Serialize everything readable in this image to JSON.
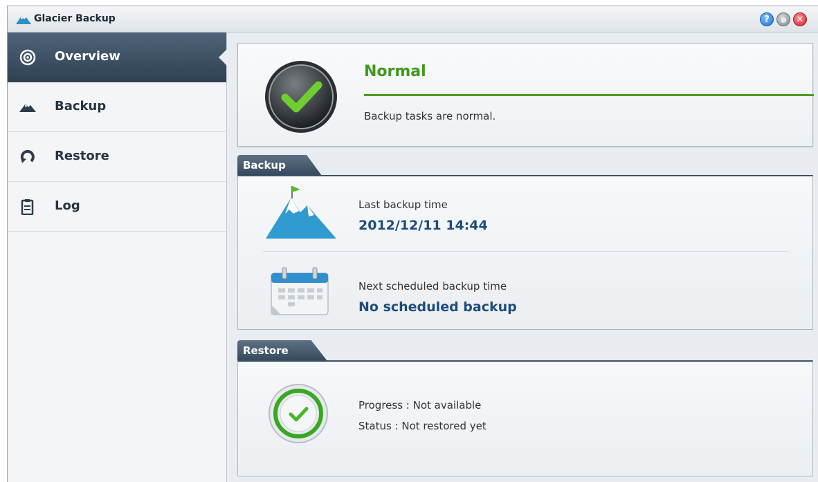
{
  "window": {
    "title": "Glacier Backup"
  },
  "titlebar_buttons": {
    "help": "?",
    "minimize": "",
    "close": "✕"
  },
  "sidebar": {
    "items": [
      {
        "label": "Overview",
        "icon": "eye-icon",
        "active": true
      },
      {
        "label": "Backup",
        "icon": "mountain-icon",
        "active": false
      },
      {
        "label": "Restore",
        "icon": "restore-icon",
        "active": false
      },
      {
        "label": "Log",
        "icon": "clipboard-icon",
        "active": false
      }
    ]
  },
  "status": {
    "title": "Normal",
    "description": "Backup tasks are normal.",
    "color": "#3f9a1f"
  },
  "backup": {
    "tab_label": "Backup",
    "last_label": "Last backup time",
    "last_value": "2012/12/11 14:44",
    "next_label": "Next scheduled backup time",
    "next_value": "No scheduled backup"
  },
  "restore": {
    "tab_label": "Restore",
    "progress": "Progress : Not available",
    "status": "Status : Not restored yet"
  }
}
